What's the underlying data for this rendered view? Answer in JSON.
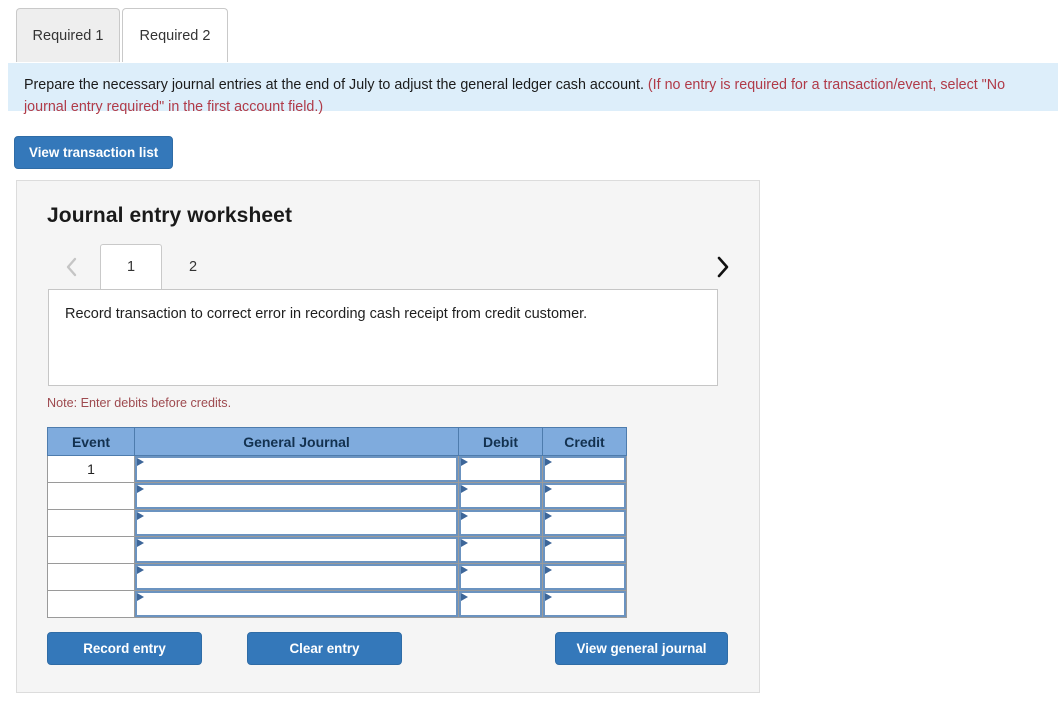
{
  "requirement_tabs": [
    {
      "label": "Required 1",
      "active": false
    },
    {
      "label": "Required 2",
      "active": true
    }
  ],
  "instruction": {
    "main_text": "Prepare the necessary journal entries at the end of July to adjust the general ledger cash account.",
    "hint_text": "(If no entry is required for a transaction/event, select \"No journal entry required\" in the first account field.)",
    "background_color": "#ddeefa",
    "hint_color": "#b03a48"
  },
  "toolbar": {
    "view_transaction_list_label": "View transaction list"
  },
  "worksheet": {
    "title": "Journal entry worksheet",
    "pager": {
      "prev_label": "‹",
      "next_label": "›",
      "prev_enabled": false,
      "next_enabled": true,
      "pages": [
        {
          "label": "1",
          "active": true
        },
        {
          "label": "2",
          "active": false
        }
      ]
    },
    "description": "Record transaction to correct error in recording cash receipt from credit customer.",
    "note": "Note: Enter debits before credits.",
    "table": {
      "headers": [
        "Event",
        "General Journal",
        "Debit",
        "Credit"
      ],
      "header_color": "#7fabdd",
      "rows": [
        {
          "event": "1",
          "general_journal": "",
          "debit": "",
          "credit": ""
        },
        {
          "event": "",
          "general_journal": "",
          "debit": "",
          "credit": ""
        },
        {
          "event": "",
          "general_journal": "",
          "debit": "",
          "credit": ""
        },
        {
          "event": "",
          "general_journal": "",
          "debit": "",
          "credit": ""
        },
        {
          "event": "",
          "general_journal": "",
          "debit": "",
          "credit": ""
        },
        {
          "event": "",
          "general_journal": "",
          "debit": "",
          "credit": ""
        }
      ]
    },
    "actions": {
      "record_entry_label": "Record entry",
      "clear_entry_label": "Clear entry",
      "view_general_journal_label": "View general journal"
    }
  },
  "theme": {
    "button_blue": "#3478ba",
    "panel_gray": "#f5f5f5"
  }
}
